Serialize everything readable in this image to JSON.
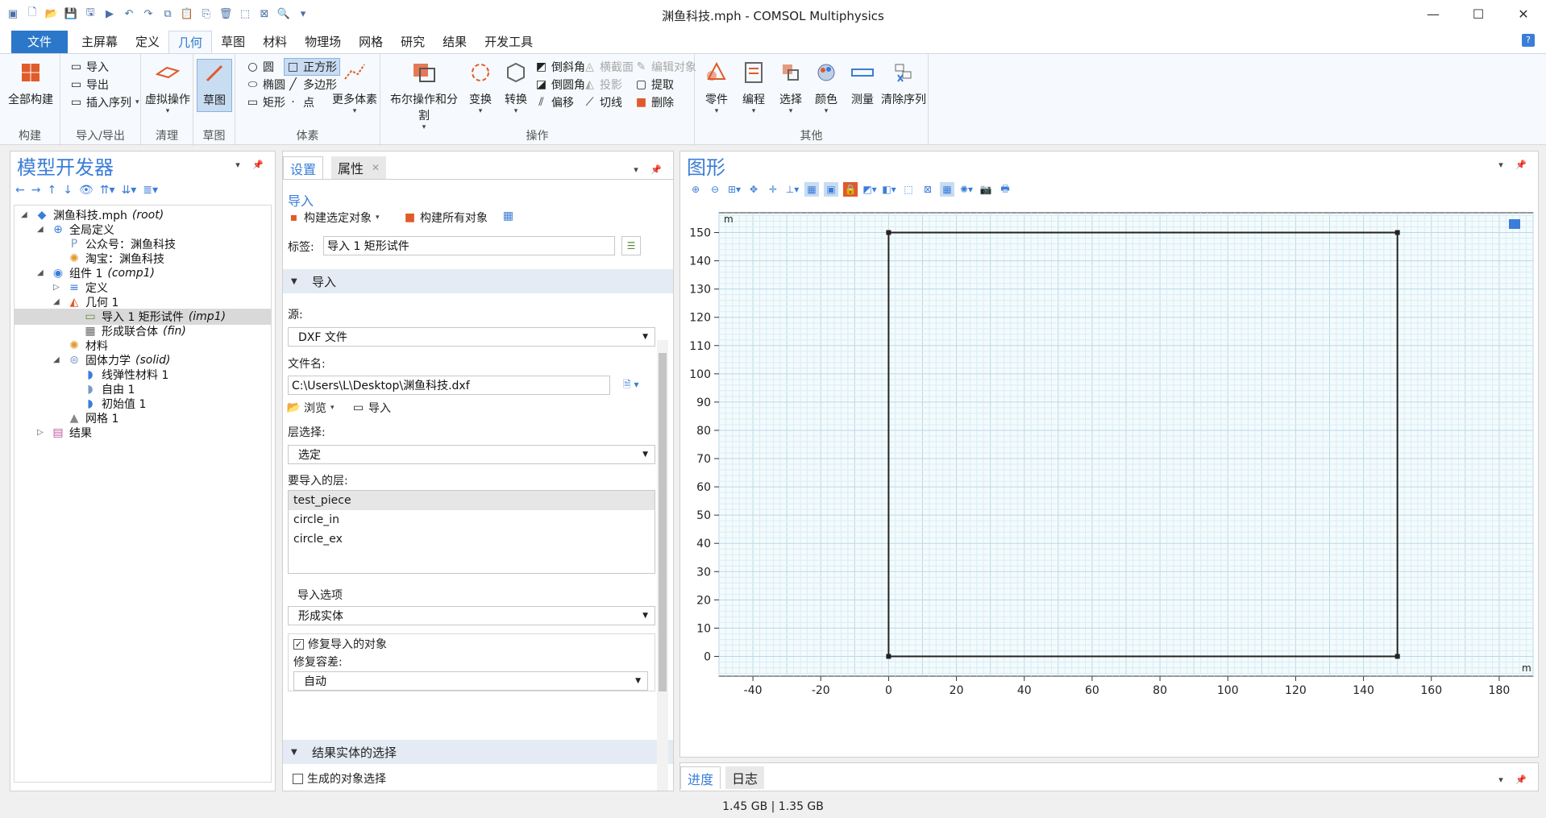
{
  "window": {
    "title": "渊鱼科技.mph - COMSOL Multiphysics",
    "minimize": "—",
    "maximize": "☐",
    "close": "✕"
  },
  "menu": {
    "items": [
      "文件",
      "主屏幕",
      "定义",
      "几何",
      "草图",
      "材料",
      "物理场",
      "网格",
      "研究",
      "结果",
      "开发工具"
    ],
    "active": "几何",
    "help": "?"
  },
  "ribbon": {
    "groups": {
      "build": "构建",
      "import_export": "导入/导出",
      "cleanup": "清理",
      "sketch": "草图",
      "primitives": "体素",
      "operations": "操作",
      "other": "其他"
    },
    "build_all": "全部构建",
    "import": "导入",
    "export": "导出",
    "insert_sequence": "插入序列",
    "virtual_ops": "虚拟操作",
    "sketch": "草图",
    "circle": "圆",
    "square": "正方形",
    "ellipse": "椭圆",
    "polygon": "多边形",
    "rectangle": "矩形",
    "point": "点",
    "more_primitives": "更多体素",
    "boolean": "布尔操作和分割",
    "transform": "变换",
    "convert": "转换",
    "chamfer": "倒斜角",
    "cross_section": "横截面",
    "edit_object": "编辑对象",
    "fillet": "倒圆角",
    "projection": "投影",
    "extract": "提取",
    "offset": "偏移",
    "tangent": "切线",
    "delete": "删除",
    "parts": "零件",
    "programming": "编程",
    "selections": "选择",
    "colors": "颜色",
    "measure": "测量",
    "clear_sequence": "清除序列"
  },
  "model_builder": {
    "title": "模型开发器",
    "tree": [
      {
        "label": "渊鱼科技.mph",
        "tag": "(root)"
      },
      {
        "label": "全局定义",
        "tag": ""
      },
      {
        "label": "公众号：渊鱼科技",
        "tag": ""
      },
      {
        "label": "淘宝：渊鱼科技",
        "tag": ""
      },
      {
        "label": "组件 1",
        "tag": "(comp1)"
      },
      {
        "label": "定义",
        "tag": ""
      },
      {
        "label": "几何 1",
        "tag": ""
      },
      {
        "label": "导入 1 矩形试件",
        "tag": "(imp1)"
      },
      {
        "label": "形成联合体",
        "tag": "(fin)"
      },
      {
        "label": "材料",
        "tag": ""
      },
      {
        "label": "固体力学",
        "tag": "(solid)"
      },
      {
        "label": "线弹性材料 1",
        "tag": ""
      },
      {
        "label": "自由 1",
        "tag": ""
      },
      {
        "label": "初始值 1",
        "tag": ""
      },
      {
        "label": "网格 1",
        "tag": ""
      },
      {
        "label": "结果",
        "tag": ""
      }
    ]
  },
  "settings": {
    "tab_settings": "设置",
    "tab_properties": "属性",
    "node_title": "导入",
    "build_selected": "构建选定对象",
    "build_all": "构建所有对象",
    "label_caption": "标签:",
    "label_value": "导入 1 矩形试件",
    "section_import": "导入",
    "source_caption": "源:",
    "source_value": "DXF 文件",
    "filename_caption": "文件名:",
    "filename_value": "C:\\Users\\L\\Desktop\\渊鱼科技.dxf",
    "browse": "浏览",
    "import_btn": "导入",
    "layer_sel_caption": "层选择:",
    "layer_sel_value": "选定",
    "layers_caption": "要导入的层:",
    "layers": [
      "test_piece",
      "circle_in",
      "circle_ex"
    ],
    "import_options_caption": "导入选项",
    "import_option_value": "形成实体",
    "repair_label": "修复导入的对象",
    "repair_tol_caption": "修复容差:",
    "repair_tol_value": "自动",
    "section_result": "结果实体的选择",
    "generate_selection": "生成的对象选择"
  },
  "graphics": {
    "title": "图形",
    "unit": "m",
    "x_ticks": [
      "-40",
      "-20",
      "0",
      "20",
      "40",
      "60",
      "80",
      "100",
      "120",
      "140",
      "160",
      "180"
    ],
    "y_ticks": [
      "150",
      "140",
      "130",
      "120",
      "110",
      "100",
      "90",
      "80",
      "70",
      "60",
      "50",
      "40",
      "30",
      "20",
      "10",
      "0"
    ],
    "rect": {
      "x0": 0,
      "y0": 0,
      "x1": 150,
      "y1": 150
    },
    "x_range": [
      -50,
      190
    ],
    "y_range": [
      -7,
      157
    ]
  },
  "bottom_tabs": {
    "progress": "进度",
    "log": "日志"
  },
  "status": {
    "memory": "1.45 GB | 1.35 GB"
  }
}
